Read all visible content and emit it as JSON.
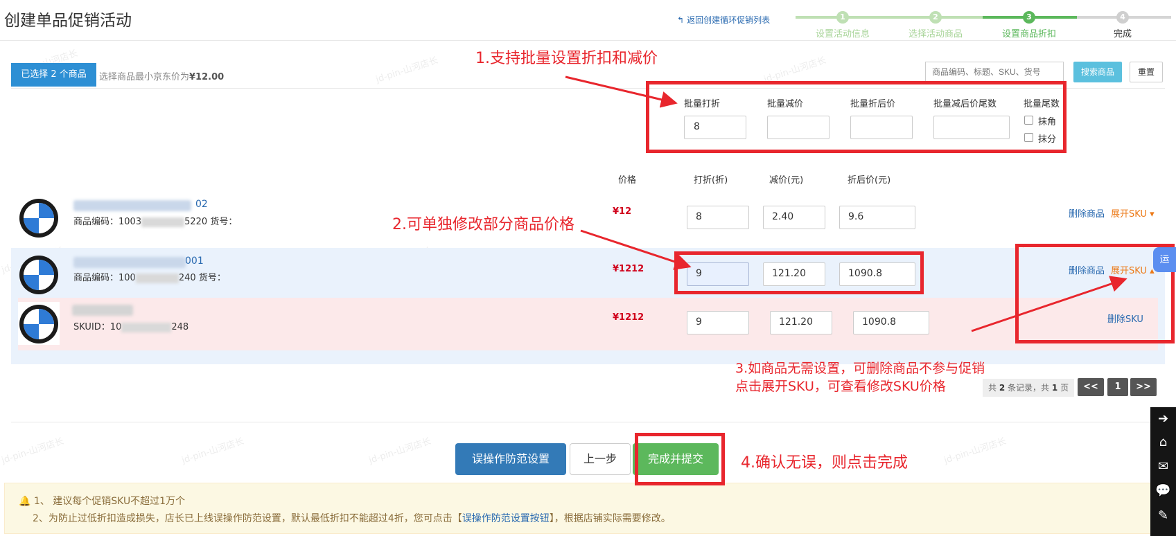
{
  "page": {
    "title": "创建单品促销活动",
    "back_link": "返回创建循环促销列表"
  },
  "steps": [
    {
      "num": "1",
      "label": "设置活动信息",
      "state": "done"
    },
    {
      "num": "2",
      "label": "选择活动商品",
      "state": "done"
    },
    {
      "num": "3",
      "label": "设置商品折扣",
      "state": "current"
    },
    {
      "num": "4",
      "label": "完成",
      "state": "todo"
    }
  ],
  "selection": {
    "button": "已选择 2 个商品",
    "info_prefix": "选择商品最小京东价为",
    "info_value": "¥12.00"
  },
  "search": {
    "placeholder": "商品编码、标题、SKU、货号",
    "search_button": "搜索商品",
    "reset_button": "重置"
  },
  "batch": {
    "discount_label": "批量打折",
    "discount_value": "8",
    "reduce_label": "批量减价",
    "reduce_value": "",
    "after_label": "批量折后价",
    "after_value": "",
    "tail_label": "批量减后价尾数",
    "tail_value": "",
    "round_label": "批量尾数",
    "opt_jiao": "抹角",
    "opt_fen": "抹分"
  },
  "table": {
    "headers": {
      "price": "价格",
      "discount": "打折(折)",
      "reduce": "减价(元)",
      "after": "折后价(元)"
    },
    "rows": [
      {
        "title_suffix": "02",
        "code_label": "商品编码：",
        "code_start": "1003",
        "code_end": "5220",
        "huohao": "货号：",
        "price": "¥12",
        "discount": "8",
        "reduce": "2.40",
        "after": "9.6",
        "delete": "删除商品",
        "expand": "展开SKU"
      },
      {
        "title_suffix": "001",
        "code_label": "商品编码：",
        "code_start": "100",
        "code_end": "240",
        "huohao": "货号：",
        "price": "¥1212",
        "discount": "9",
        "reduce": "121.20",
        "after": "1090.8",
        "delete": "删除商品",
        "expand": "展开SKU"
      }
    ],
    "sku_row": {
      "sku_label": "SKUID：",
      "sku_start": "10",
      "sku_end": "248",
      "price": "¥1212",
      "discount": "9",
      "reduce": "121.20",
      "after": "1090.8",
      "delete": "删除SKU"
    }
  },
  "pagination": {
    "total_prefix": "共",
    "total_records": "2",
    "total_mid": "条记录，共",
    "total_pages": "1",
    "total_suffix": "页",
    "prev": "<<",
    "current": "1",
    "next": ">>"
  },
  "footer": {
    "guard_button": "误操作防范设置",
    "prev_button": "上一步",
    "submit_button": "完成并提交"
  },
  "notice": {
    "line1": "1、 建议每个促销SKU不超过1万个",
    "line2_prefix": "2、为防止过低折扣造成损失，店长已上线误操作防范设置，默认最低折扣不能超过4折，您可点击【",
    "line2_link": "误操作防范设置按钮",
    "line2_suffix": "】，根据店铺实际需要修改。"
  },
  "annotations": {
    "a1": "1.支持批量设置折扣和减价",
    "a2": "2.可单独修改部分商品价格",
    "a3_line1": "3.如商品无需设置，可删除商品不参与促销",
    "a3_line2": "点击展开SKU，可查看修改SKU价格",
    "a4": "4.确认无误，则点击完成"
  },
  "watermark": "jd-pin-山河店长",
  "float_icon": "运",
  "colors": {
    "primary": "#337ab7",
    "success": "#5cb85c",
    "annotation": "#e8262d",
    "price": "#d0011b",
    "link_orange": "#ec7a18"
  }
}
